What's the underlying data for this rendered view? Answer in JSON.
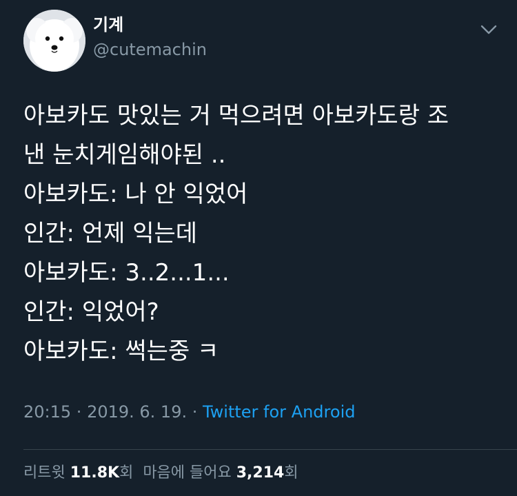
{
  "user": {
    "display_name": "기계",
    "handle": "@cutemachin",
    "avatar_icon": "white-dog-avatar-icon"
  },
  "tweet": {
    "lines": [
      "아보카도 맛있는 거 먹으려면 아보카도랑 조",
      "낸 눈치게임해야된 ..",
      "아보카도: 나 안 익었어",
      "인간: 언제 익는데",
      "아보카도: 3..2...1...",
      "인간: 익었어?",
      "아보카도: 썩는중 ㅋ"
    ]
  },
  "meta": {
    "time": "20:15",
    "separator": " · ",
    "date": "2019. 6. 19.",
    "source": "Twitter for Android"
  },
  "stats": {
    "retweets_label": "리트윗",
    "retweets_count": "11.8K",
    "retweets_suffix": "회",
    "likes_label": "마음에 들어요",
    "likes_count": "3,214",
    "likes_suffix": "회"
  },
  "colors": {
    "background": "#15202b",
    "text_primary": "#ffffff",
    "text_secondary": "#8899a6",
    "link": "#1da1f2",
    "divider": "#38444d"
  },
  "icons": {
    "more_menu": "chevron-down-icon"
  }
}
